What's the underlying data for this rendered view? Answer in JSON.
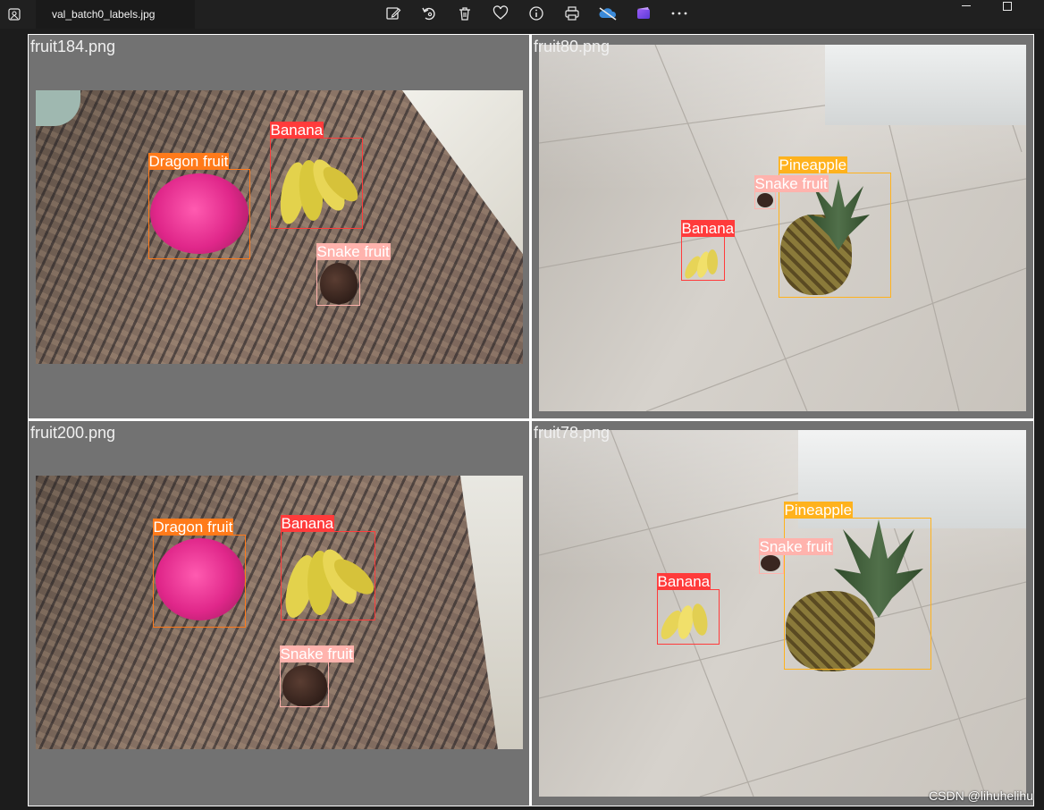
{
  "window": {
    "tab_title": "val_batch0_labels.jpg",
    "toolbar": [
      {
        "name": "edit-image-icon"
      },
      {
        "name": "rotate-icon"
      },
      {
        "name": "delete-icon"
      },
      {
        "name": "favorite-icon"
      },
      {
        "name": "info-icon"
      },
      {
        "name": "print-icon"
      },
      {
        "name": "onedrive-icon"
      },
      {
        "name": "clipchamp-icon"
      },
      {
        "name": "more-icon"
      }
    ]
  },
  "colors": {
    "dragon_fruit": "#ff7a1a",
    "banana": "#ff3b3b",
    "snake_fruit": "#ffb3ad",
    "pineapple": "#ffb21d"
  },
  "images": [
    {
      "label": "fruit184.png",
      "boxes": [
        {
          "label": "Dragon fruit",
          "color": "#ff7a1a"
        },
        {
          "label": "Banana",
          "color": "#ff3b3b"
        },
        {
          "label": "Snake fruit",
          "color": "#ffb3ad"
        }
      ]
    },
    {
      "label": "fruit80.png",
      "boxes": [
        {
          "label": "Pineapple",
          "color": "#ffb21d"
        },
        {
          "label": "Snake fruit",
          "color": "#ffb3ad"
        },
        {
          "label": "Banana",
          "color": "#ff3b3b"
        }
      ]
    },
    {
      "label": "fruit200.png",
      "boxes": [
        {
          "label": "Dragon fruit",
          "color": "#ff7a1a"
        },
        {
          "label": "Banana",
          "color": "#ff3b3b"
        },
        {
          "label": "Snake fruit",
          "color": "#ffb3ad"
        }
      ]
    },
    {
      "label": "fruit78.png",
      "boxes": [
        {
          "label": "Pineapple",
          "color": "#ffb21d"
        },
        {
          "label": "Snake fruit",
          "color": "#ffb3ad"
        },
        {
          "label": "Banana",
          "color": "#ff3b3b"
        }
      ]
    }
  ],
  "watermark": "CSDN @lihuhelihu"
}
